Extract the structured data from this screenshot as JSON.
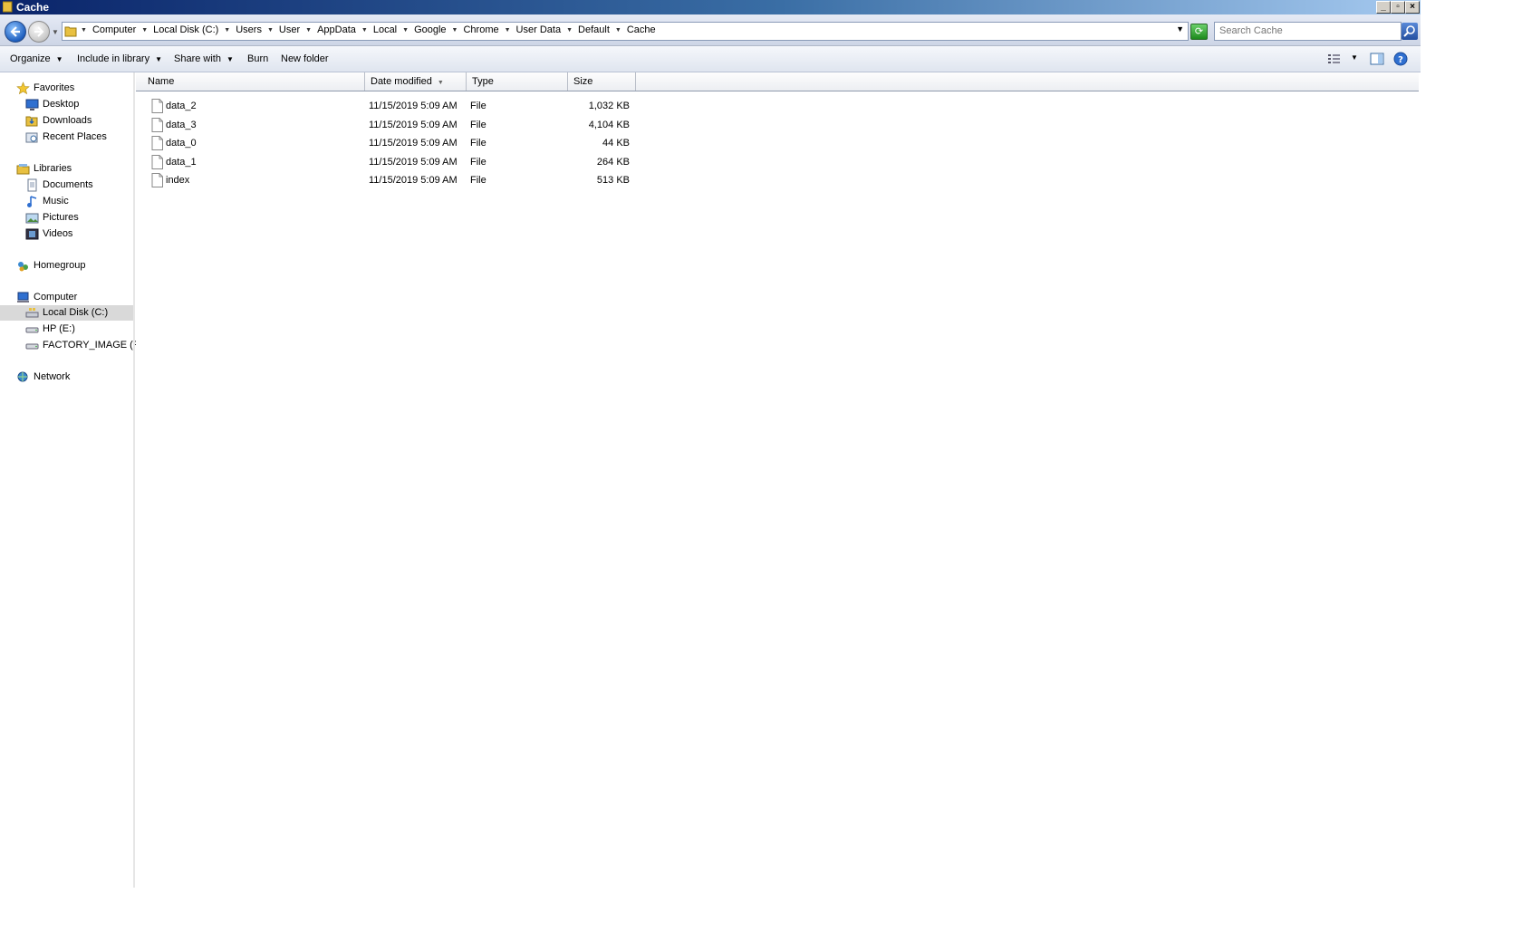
{
  "window": {
    "title": "Cache"
  },
  "address": {
    "crumbs": [
      "Computer",
      "Local Disk (C:)",
      "Users",
      "User",
      "AppData",
      "Local",
      "Google",
      "Chrome",
      "User Data",
      "Default",
      "Cache"
    ]
  },
  "search": {
    "placeholder": "Search Cache"
  },
  "toolbar": {
    "organize": "Organize",
    "include_in_library": "Include in library",
    "share_with": "Share with",
    "burn": "Burn",
    "new_folder": "New folder"
  },
  "sidebar": {
    "favorites": "Favorites",
    "desktop": "Desktop",
    "downloads": "Downloads",
    "recent_places": "Recent Places",
    "libraries": "Libraries",
    "documents": "Documents",
    "music": "Music",
    "pictures": "Pictures",
    "videos": "Videos",
    "homegroup": "Homegroup",
    "computer": "Computer",
    "local_disk": "Local Disk (C:)",
    "hp": "HP (E:)",
    "factory_image": "FACTORY_IMAGE (F:)",
    "network": "Network"
  },
  "columns": {
    "name": "Name",
    "date_modified": "Date modified",
    "type": "Type",
    "size": "Size"
  },
  "files": [
    {
      "name": "data_2",
      "date": "11/15/2019 5:09 AM",
      "type": "File",
      "size": "1,032 KB"
    },
    {
      "name": "data_3",
      "date": "11/15/2019 5:09 AM",
      "type": "File",
      "size": "4,104 KB"
    },
    {
      "name": "data_0",
      "date": "11/15/2019 5:09 AM",
      "type": "File",
      "size": "44 KB"
    },
    {
      "name": "data_1",
      "date": "11/15/2019 5:09 AM",
      "type": "File",
      "size": "264 KB"
    },
    {
      "name": "index",
      "date": "11/15/2019 5:09 AM",
      "type": "File",
      "size": "513 KB"
    }
  ],
  "colors": {
    "title_bar": "#0a246a",
    "selection": "#d9d9d9"
  }
}
